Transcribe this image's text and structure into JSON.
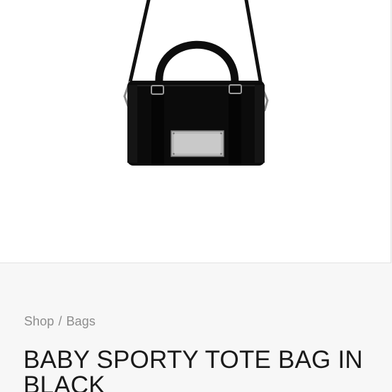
{
  "product": {
    "image_alt": "black tote bag with shoulder strap",
    "title": "BABY SPORTY TOTE BAG IN BLACK"
  },
  "breadcrumb": {
    "items": [
      "Shop",
      "Bags"
    ],
    "separator": "/"
  },
  "colors": {
    "page_background": "#f7f7f7",
    "image_background": "#ffffff",
    "breadcrumb_text": "#8d8d8d",
    "title_text": "#1a1a1a",
    "bag_body": "#0b0b0b",
    "metal_plate": "#b9b9b9"
  }
}
